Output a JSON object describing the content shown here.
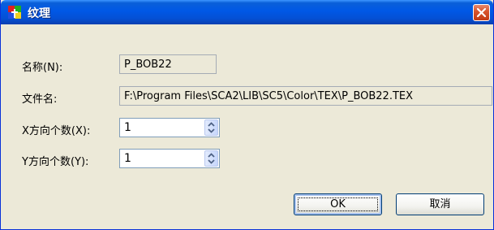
{
  "window": {
    "title": "纹理",
    "app_icon": "texture-app-icon",
    "close_icon": "close-icon"
  },
  "form": {
    "name_label": "名称(N):",
    "name_value": "P_BOB22",
    "filename_label": "文件名:",
    "filename_value": "F:\\Program Files\\SCA2\\LIB\\SC5\\Color\\TEX\\P_BOB22.TEX",
    "x_count_label": "X方向个数(X):",
    "x_count_value": "1",
    "y_count_label": "Y方向个数(Y):",
    "y_count_value": "1"
  },
  "buttons": {
    "ok_label": "OK",
    "cancel_label": "取消"
  },
  "colors": {
    "titlebar": "#0058e6",
    "dialog_bg": "#ece9d8",
    "close_button": "#d9552e"
  }
}
